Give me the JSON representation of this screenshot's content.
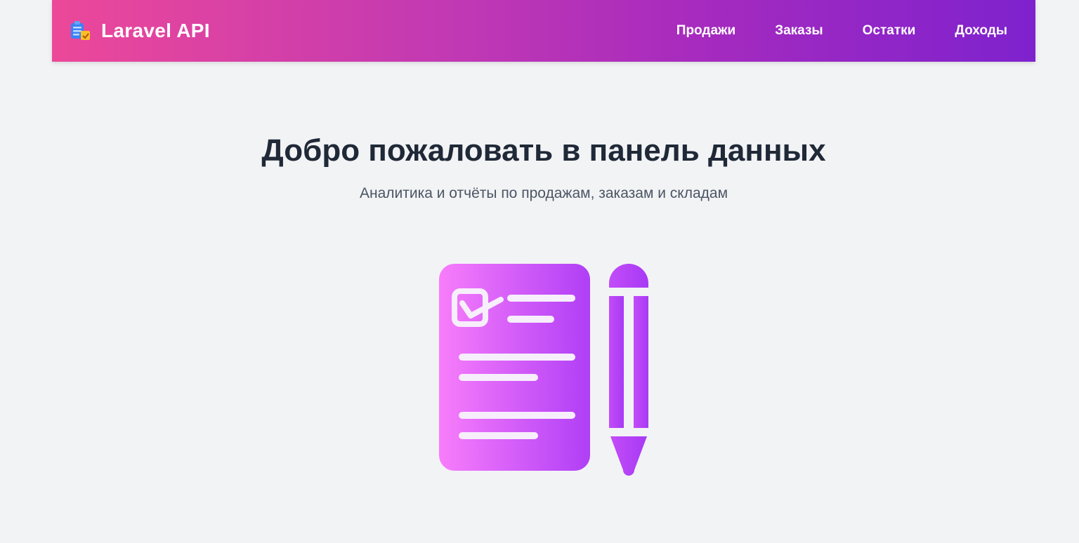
{
  "app": {
    "brand": "Laravel API",
    "brand_icon": "clipboard-chart-icon"
  },
  "nav": {
    "items": [
      {
        "label": "Продажи"
      },
      {
        "label": "Заказы"
      },
      {
        "label": "Остатки"
      },
      {
        "label": "Доходы"
      }
    ]
  },
  "hero": {
    "title": "Добро пожаловать в панель данных",
    "subtitle": "Аналитика и отчёты по продажам, заказам и складам",
    "illustration": "checklist-and-pencil-icon"
  },
  "colors": {
    "nav_gradient_start": "#ec4899",
    "nav_gradient_end": "#7e22ce",
    "illustration_light": "#f67dfb",
    "illustration_dark": "#b13ff7",
    "background": "#f2f3f5",
    "title_text": "#1f2937",
    "subtitle_text": "#4b5563"
  }
}
